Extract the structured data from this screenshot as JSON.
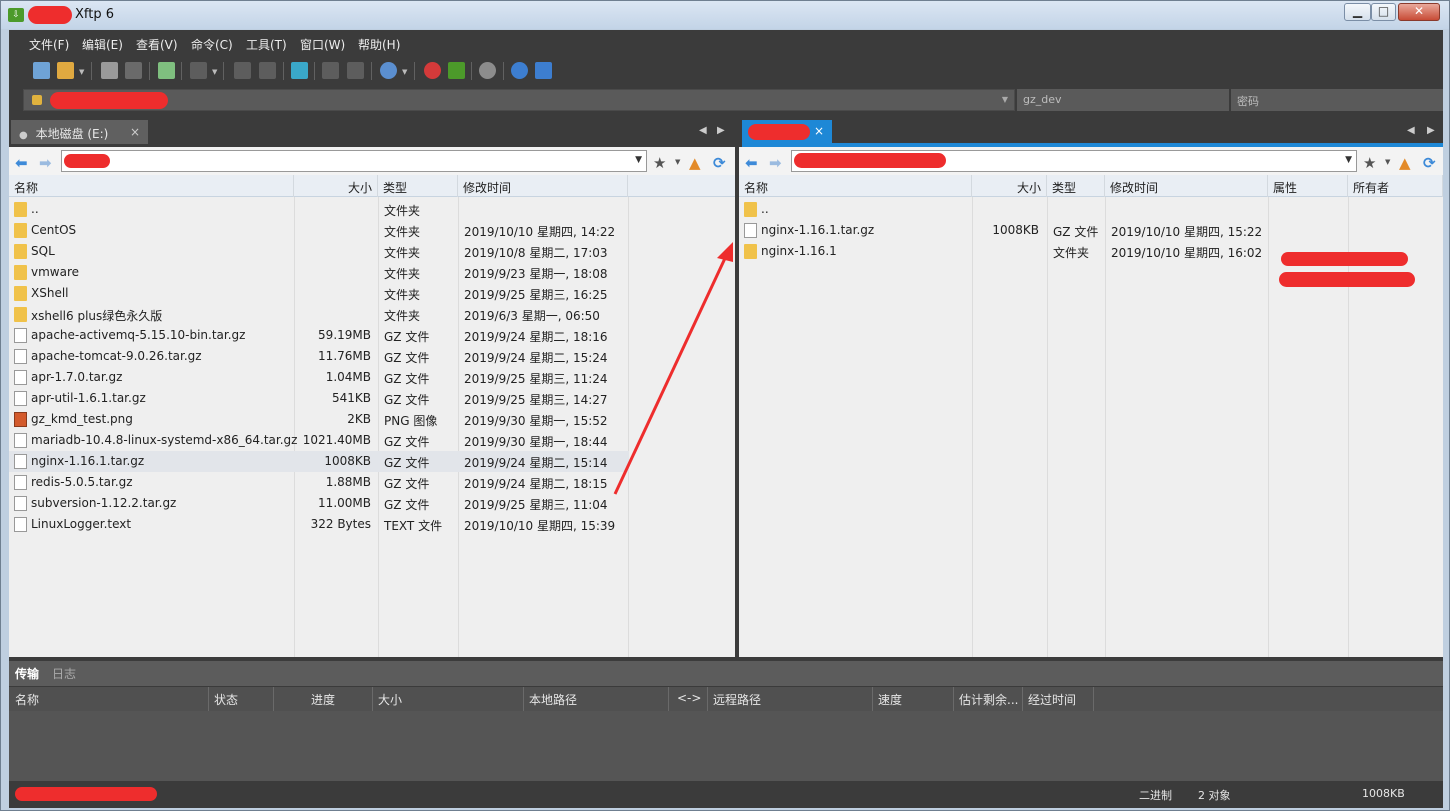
{
  "window": {
    "title": "Xftp 6",
    "min": "▁",
    "max": "□",
    "close": "✕"
  },
  "menu": [
    "文件(F)",
    "编辑(E)",
    "查看(V)",
    "命令(C)",
    "工具(T)",
    "窗口(W)",
    "帮助(H)"
  ],
  "address": {
    "user": "gz_dev",
    "password_placeholder": "密码"
  },
  "local_tab": {
    "label": "本地磁盘 (E:)",
    "bullet": "●"
  },
  "remote_tab": {
    "close": "×"
  },
  "nav": {
    "back": "◀",
    "fwd": "▶",
    "prev_tab": "◀",
    "next_tab": "▶"
  },
  "local_headers": {
    "name": "名称",
    "size": "大小",
    "type": "类型",
    "mtime": "修改时间"
  },
  "local_rows": [
    {
      "icon": "folder",
      "name": "..",
      "size": "",
      "type": "文件夹",
      "mtime": ""
    },
    {
      "icon": "folder",
      "name": "CentOS",
      "size": "",
      "type": "文件夹",
      "mtime": "2019/10/10 星期四, 14:22"
    },
    {
      "icon": "folder",
      "name": "SQL",
      "size": "",
      "type": "文件夹",
      "mtime": "2019/10/8 星期二, 17:03"
    },
    {
      "icon": "folder",
      "name": "vmware",
      "size": "",
      "type": "文件夹",
      "mtime": "2019/9/23 星期一, 18:08"
    },
    {
      "icon": "folder",
      "name": "XShell",
      "size": "",
      "type": "文件夹",
      "mtime": "2019/9/25 星期三, 16:25"
    },
    {
      "icon": "folder",
      "name": "xshell6 plus绿色永久版",
      "size": "",
      "type": "文件夹",
      "mtime": "2019/6/3 星期一, 06:50"
    },
    {
      "icon": "file",
      "name": "apache-activemq-5.15.10-bin.tar.gz",
      "size": "59.19MB",
      "type": "GZ 文件",
      "mtime": "2019/9/24 星期二, 18:16"
    },
    {
      "icon": "file",
      "name": "apache-tomcat-9.0.26.tar.gz",
      "size": "11.76MB",
      "type": "GZ 文件",
      "mtime": "2019/9/24 星期二, 15:24"
    },
    {
      "icon": "file",
      "name": "apr-1.7.0.tar.gz",
      "size": "1.04MB",
      "type": "GZ 文件",
      "mtime": "2019/9/25 星期三, 11:24"
    },
    {
      "icon": "file",
      "name": "apr-util-1.6.1.tar.gz",
      "size": "541KB",
      "type": "GZ 文件",
      "mtime": "2019/9/25 星期三, 14:27"
    },
    {
      "icon": "png",
      "name": "gz_kmd_test.png",
      "size": "2KB",
      "type": "PNG 图像",
      "mtime": "2019/9/30 星期一, 15:52"
    },
    {
      "icon": "file",
      "name": "mariadb-10.4.8-linux-systemd-x86_64.tar.gz",
      "size": "1021.40MB",
      "type": "GZ 文件",
      "mtime": "2019/9/30 星期一, 18:44"
    },
    {
      "icon": "file",
      "name": "nginx-1.16.1.tar.gz",
      "size": "1008KB",
      "type": "GZ 文件",
      "mtime": "2019/9/24 星期二, 15:14",
      "selected": true
    },
    {
      "icon": "file",
      "name": "redis-5.0.5.tar.gz",
      "size": "1.88MB",
      "type": "GZ 文件",
      "mtime": "2019/9/24 星期二, 18:15"
    },
    {
      "icon": "file",
      "name": "subversion-1.12.2.tar.gz",
      "size": "11.00MB",
      "type": "GZ 文件",
      "mtime": "2019/9/25 星期三, 11:04"
    },
    {
      "icon": "file",
      "name": "LinuxLogger.text",
      "size": "322 Bytes",
      "type": "TEXT 文件",
      "mtime": "2019/10/10 星期四, 15:39"
    }
  ],
  "remote_headers": {
    "name": "名称",
    "size": "大小",
    "type": "类型",
    "mtime": "修改时间",
    "attr": "属性",
    "owner": "所有者"
  },
  "remote_rows": [
    {
      "icon": "folder",
      "name": "..",
      "size": "",
      "type": "",
      "mtime": ""
    },
    {
      "icon": "file",
      "name": "nginx-1.16.1.tar.gz",
      "size": "1008KB",
      "type": "GZ 文件",
      "mtime": "2019/10/10 星期四, 15:22"
    },
    {
      "icon": "folder",
      "name": "nginx-1.16.1",
      "size": "",
      "type": "文件夹",
      "mtime": "2019/10/10 星期四, 16:02"
    }
  ],
  "bottom_tabs": {
    "transfer": "传输",
    "log": "日志"
  },
  "transfer_headers": [
    "名称",
    "状态",
    "进度",
    "大小",
    "本地路径",
    "<->",
    "远程路径",
    "速度",
    "估计剩余...",
    "经过时间"
  ],
  "status": {
    "mode": "二进制",
    "count": "2 对象",
    "size": "1008KB"
  },
  "colors": {
    "accent": "#1e88d6",
    "redaction": "#ee2d2d",
    "folder": "#f0c24a"
  },
  "icons": [
    "new-session-icon",
    "open-folder-icon",
    "connect-icon",
    "disconnect-icon",
    "new-tab-icon",
    "terminal-icon",
    "copy-icon",
    "paste-icon",
    "transfer-icon",
    "globe-icon",
    "xshell-icon",
    "xftp-icon",
    "settings-icon",
    "help-icon",
    "chat-icon",
    "lock-icon",
    "star-icon",
    "upload-folder-icon",
    "refresh-icon"
  ]
}
